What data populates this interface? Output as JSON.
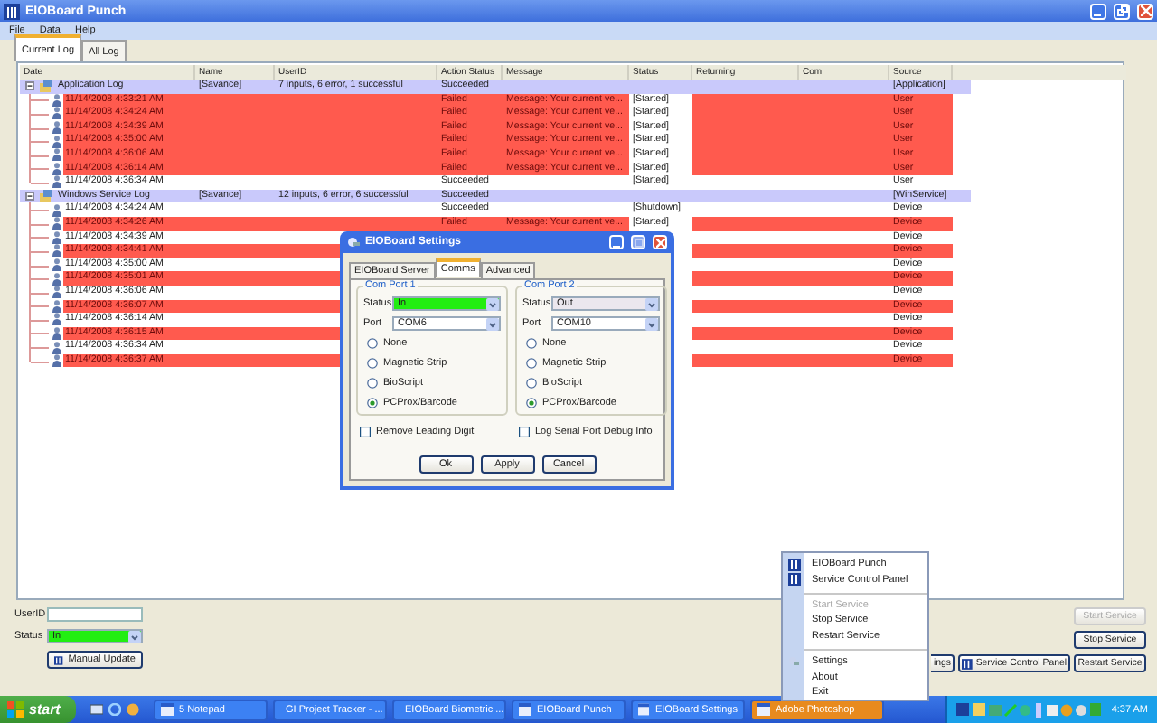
{
  "window": {
    "title": "EIOBoard Punch"
  },
  "menu": [
    "File",
    "Data",
    "Help"
  ],
  "tabs": [
    {
      "label": "Current Log",
      "selected": true
    },
    {
      "label": "All Log",
      "selected": false
    }
  ],
  "log": {
    "columns": [
      "Date",
      "Name",
      "UserID",
      "Action Status",
      "Message",
      "Status",
      "Returning",
      "Com",
      "Source"
    ],
    "groups": [
      {
        "name": "Application Log",
        "user": "[Savance]",
        "user_id": "7 inputs, 6 error, 1 successful",
        "action_status": "Succeeded",
        "source": "[Application]",
        "expanded": true,
        "children": [
          {
            "date": "11/14/2008 4:33:21 AM",
            "failed": true,
            "action_status": "Failed",
            "message": "Message: Your current ve...",
            "status": "[Started]",
            "source": "User"
          },
          {
            "date": "11/14/2008 4:34:24 AM",
            "failed": true,
            "action_status": "Failed",
            "message": "Message: Your current ve...",
            "status": "[Started]",
            "source": "User"
          },
          {
            "date": "11/14/2008 4:34:39 AM",
            "failed": true,
            "action_status": "Failed",
            "message": "Message: Your current ve...",
            "status": "[Started]",
            "source": "User"
          },
          {
            "date": "11/14/2008 4:35:00 AM",
            "failed": true,
            "action_status": "Failed",
            "message": "Message: Your current ve...",
            "status": "[Started]",
            "source": "User"
          },
          {
            "date": "11/14/2008 4:36:06 AM",
            "failed": true,
            "action_status": "Failed",
            "message": "Message: Your current ve...",
            "status": "[Started]",
            "source": "User"
          },
          {
            "date": "11/14/2008 4:36:14 AM",
            "failed": true,
            "action_status": "Failed",
            "message": "Message: Your current ve...",
            "status": "[Started]",
            "source": "User"
          },
          {
            "date": "11/14/2008 4:36:34 AM",
            "failed": false,
            "action_status": "Succeeded",
            "status": "[Started]",
            "source": "User"
          }
        ]
      },
      {
        "name": "Windows Service Log",
        "user": "[Savance]",
        "user_id": "12 inputs, 6 error, 6 successful",
        "action_status": "Succeeded",
        "source": "[WinService]",
        "expanded": true,
        "children": [
          {
            "date": "11/14/2008 4:34:24 AM",
            "failed": false,
            "action_status": "Succeeded",
            "status": "[Shutdown]",
            "source": "Device"
          },
          {
            "date": "11/14/2008 4:34:26 AM",
            "failed": true,
            "action_status": "Failed",
            "message": "Message: Your current ve...",
            "status": "[Started]",
            "source": "Device"
          },
          {
            "date": "11/14/2008 4:34:39 AM",
            "failed": false,
            "source": "Device"
          },
          {
            "date": "11/14/2008 4:34:41 AM",
            "failed": true,
            "source": "Device"
          },
          {
            "date": "11/14/2008 4:35:00 AM",
            "failed": false,
            "source": "Device"
          },
          {
            "date": "11/14/2008 4:35:01 AM",
            "failed": true,
            "source": "Device"
          },
          {
            "date": "11/14/2008 4:36:06 AM",
            "failed": false,
            "source": "Device"
          },
          {
            "date": "11/14/2008 4:36:07 AM",
            "failed": true,
            "source": "Device"
          },
          {
            "date": "11/14/2008 4:36:14 AM",
            "failed": false,
            "source": "Device"
          },
          {
            "date": "11/14/2008 4:36:15 AM",
            "failed": true,
            "source": "Device"
          },
          {
            "date": "11/14/2008 4:36:34 AM",
            "failed": false,
            "source": "Device"
          },
          {
            "date": "11/14/2008 4:36:37 AM",
            "failed": true,
            "source": "Device"
          }
        ]
      }
    ]
  },
  "user_id_field": {
    "label": "UserID"
  },
  "status_field": {
    "label": "Status",
    "value": "In",
    "color": "#22ee11"
  },
  "manual_update_button": "Manual Update",
  "service_buttons": [
    {
      "label": "Start Service",
      "disabled": true
    },
    {
      "label": "Stop Service",
      "disabled": false
    },
    {
      "label": "ings",
      "disabled": false
    },
    {
      "label": "Service Control Panel",
      "disabled": false
    },
    {
      "label": "Restart Service",
      "disabled": false
    }
  ],
  "settings_dialog": {
    "title": "EIOBoard Settings",
    "tabs": [
      {
        "label": "EIOBoard Server",
        "selected": false
      },
      {
        "label": "Comms",
        "selected": true
      },
      {
        "label": "Advanced",
        "selected": false
      }
    ],
    "ports": [
      {
        "title": "Com Port 1",
        "status_label": "Status",
        "status": "In",
        "color": "#22ee11",
        "port_label": "Port",
        "port": "COM6",
        "options": [
          {
            "label": "None",
            "selected": false
          },
          {
            "label": "Magnetic Strip",
            "selected": false
          },
          {
            "label": "BioScript",
            "selected": false
          },
          {
            "label": "PCProx/Barcode",
            "selected": true
          }
        ],
        "checkbox": {
          "label": "Remove Leading Digit",
          "checked": false
        }
      },
      {
        "title": "Com Port 2",
        "status_label": "Status",
        "status": "Out",
        "color": "#ebe7ee",
        "port_label": "Port",
        "port": "COM10",
        "options": [
          {
            "label": "None",
            "selected": false
          },
          {
            "label": "Magnetic Strip",
            "selected": false
          },
          {
            "label": "BioScript",
            "selected": false
          },
          {
            "label": "PCProx/Barcode",
            "selected": true
          }
        ],
        "checkbox": {
          "label": "Log Serial Port Debug Info",
          "checked": false
        }
      }
    ],
    "buttons": [
      "Ok",
      "Apply",
      "Cancel"
    ]
  },
  "tray_menu": [
    {
      "kind": "item",
      "label": "EIOBoard Punch",
      "disabled": false
    },
    {
      "kind": "item",
      "label": "Service Control Panel",
      "disabled": false
    },
    {
      "kind": "separator"
    },
    {
      "kind": "item",
      "label": "Start Service",
      "disabled": true
    },
    {
      "kind": "item",
      "label": "Stop Service",
      "disabled": false
    },
    {
      "kind": "item",
      "label": "Restart Service",
      "disabled": false
    },
    {
      "kind": "separator"
    },
    {
      "kind": "item",
      "label": "Settings",
      "disabled": false
    },
    {
      "kind": "item",
      "label": "About",
      "disabled": false
    },
    {
      "kind": "item",
      "label": "Exit",
      "disabled": false
    }
  ],
  "taskbar": {
    "start": "start",
    "tasks": [
      {
        "label": "5 Notepad",
        "highlighted": false
      },
      {
        "label": "GI Project Tracker - ...",
        "highlighted": false
      },
      {
        "label": "EIOBoard Biometric ...",
        "highlighted": false
      },
      {
        "label": "EIOBoard Punch",
        "highlighted": false
      },
      {
        "label": "EIOBoard Settings",
        "highlighted": false
      },
      {
        "label": "Adobe Photoshop",
        "highlighted": true
      }
    ],
    "clock": "4:37 AM"
  }
}
